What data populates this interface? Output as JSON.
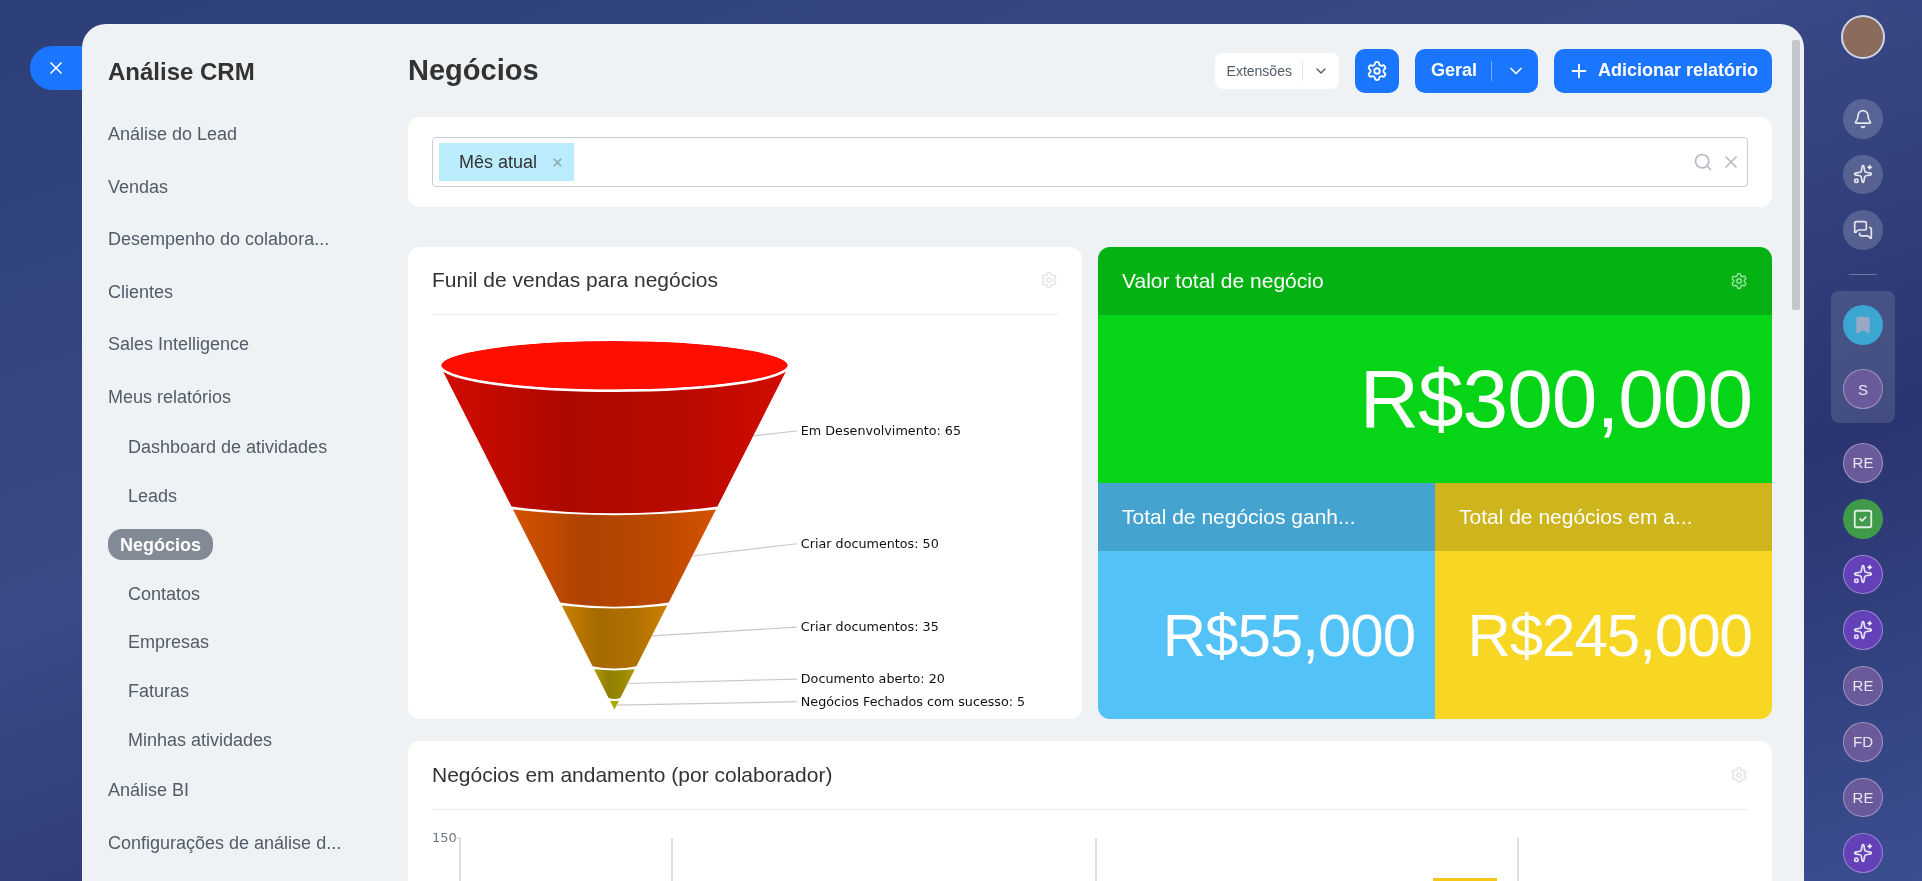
{
  "sidebar": {
    "title": "Análise CRM",
    "items": [
      {
        "label": "Análise do Lead",
        "selected": false
      },
      {
        "label": "Vendas",
        "selected": false
      },
      {
        "label": "Desempenho do colabora...",
        "selected": false
      },
      {
        "label": "Clientes",
        "selected": false
      },
      {
        "label": "Sales Intelligence",
        "selected": false
      },
      {
        "label": "Meus relatórios",
        "selected": false,
        "children": [
          {
            "label": "Dashboard de atividades",
            "selected": false
          },
          {
            "label": "Leads",
            "selected": false
          },
          {
            "label": "Negócios",
            "selected": true
          },
          {
            "label": "Contatos",
            "selected": false
          },
          {
            "label": "Empresas",
            "selected": false
          },
          {
            "label": "Faturas",
            "selected": false
          },
          {
            "label": "Minhas atividades",
            "selected": false
          }
        ]
      },
      {
        "label": "Análise BI",
        "selected": false
      },
      {
        "label": "Configurações de análise d...",
        "selected": false
      }
    ]
  },
  "header": {
    "title": "Negócios",
    "extensions": "Extensões",
    "view": "Geral",
    "add": "Adicionar relatório"
  },
  "filter": {
    "tags": [
      "Mês atual"
    ]
  },
  "funnel": {
    "title": "Funil de vendas para negócios",
    "stages": [
      {
        "label": "Em Desenvolvimento: 65",
        "color": "#d20b00"
      },
      {
        "label": "Criar documentos: 50",
        "color": "#d45200"
      },
      {
        "label": "Criar documentos: 35",
        "color": "#c98000"
      },
      {
        "label": "Documento aberto: 20",
        "color": "#b09a00"
      },
      {
        "label": "Negócios Fechados com sucesso: 5",
        "color": "#a8a800"
      }
    ]
  },
  "totals": {
    "main": {
      "title": "Valor total de negócio",
      "value": "R$300,000",
      "color": "#05d417"
    },
    "tiles": [
      {
        "title": "Total de negócios ganh...",
        "value": "R$55,000",
        "color": "#52c2f7"
      },
      {
        "title": "Total de negócios em a...",
        "value": "R$245,000",
        "color": "#f7d723"
      }
    ]
  },
  "progress": {
    "title": "Negócios em andamento (por colaborador)",
    "y_tick": "150"
  },
  "rail": {
    "top": [
      {
        "kind": "bell"
      },
      {
        "kind": "copilot"
      },
      {
        "kind": "swap"
      }
    ],
    "pinned": [
      {
        "kind": "bookmark"
      },
      {
        "kind": "initials",
        "text": "S"
      }
    ],
    "items": [
      {
        "kind": "initials",
        "text": "RE"
      },
      {
        "kind": "tasks"
      },
      {
        "kind": "copilot-app"
      },
      {
        "kind": "copilot-app"
      },
      {
        "kind": "initials",
        "text": "RE"
      },
      {
        "kind": "initials",
        "text": "FD"
      },
      {
        "kind": "initials",
        "text": "RE"
      },
      {
        "kind": "copilot-app"
      }
    ]
  }
}
